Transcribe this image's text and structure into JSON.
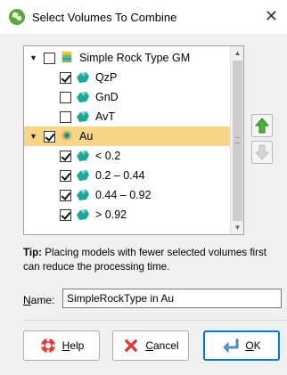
{
  "window": {
    "title": "Select Volumes To Combine",
    "close": "✕"
  },
  "tree": {
    "rows": [
      {
        "label": "Simple Rock Type GM",
        "checked": false,
        "level": 0,
        "expanded": true,
        "icon": "geological-model-icon"
      },
      {
        "label": "QzP",
        "checked": true,
        "level": 1,
        "icon": "volume-icon"
      },
      {
        "label": "GnD",
        "checked": false,
        "level": 1,
        "icon": "volume-icon"
      },
      {
        "label": "AvT",
        "checked": false,
        "level": 1,
        "icon": "volume-icon"
      },
      {
        "label": "Au",
        "checked": true,
        "level": 0,
        "expanded": true,
        "selected": true,
        "icon": "interpolant-icon"
      },
      {
        "label": "< 0.2",
        "checked": true,
        "level": 1,
        "icon": "volume-icon"
      },
      {
        "label": "0.2 – 0.44",
        "checked": true,
        "level": 1,
        "icon": "volume-icon"
      },
      {
        "label": "0.44 – 0.92",
        "checked": true,
        "level": 1,
        "icon": "volume-icon"
      },
      {
        "label": "> 0.92",
        "checked": true,
        "level": 1,
        "icon": "volume-icon"
      }
    ]
  },
  "tip": {
    "bold": "Tip:",
    "text": " Placing models with fewer selected volumes first can reduce the processing time."
  },
  "name": {
    "label_prefix": "N",
    "label_rest": "ame:",
    "value": "SimpleRockType in Au"
  },
  "buttons": {
    "help_u": "H",
    "help_rest": "elp",
    "cancel_u": "C",
    "cancel_rest": "ancel",
    "ok_u": "O",
    "ok_rest": "K"
  },
  "colors": {
    "selection": "#f9d58a",
    "volume_teal": "#1fa89a",
    "up_arrow_green": "#4caf3a",
    "ok_focus": "#0078d7"
  }
}
